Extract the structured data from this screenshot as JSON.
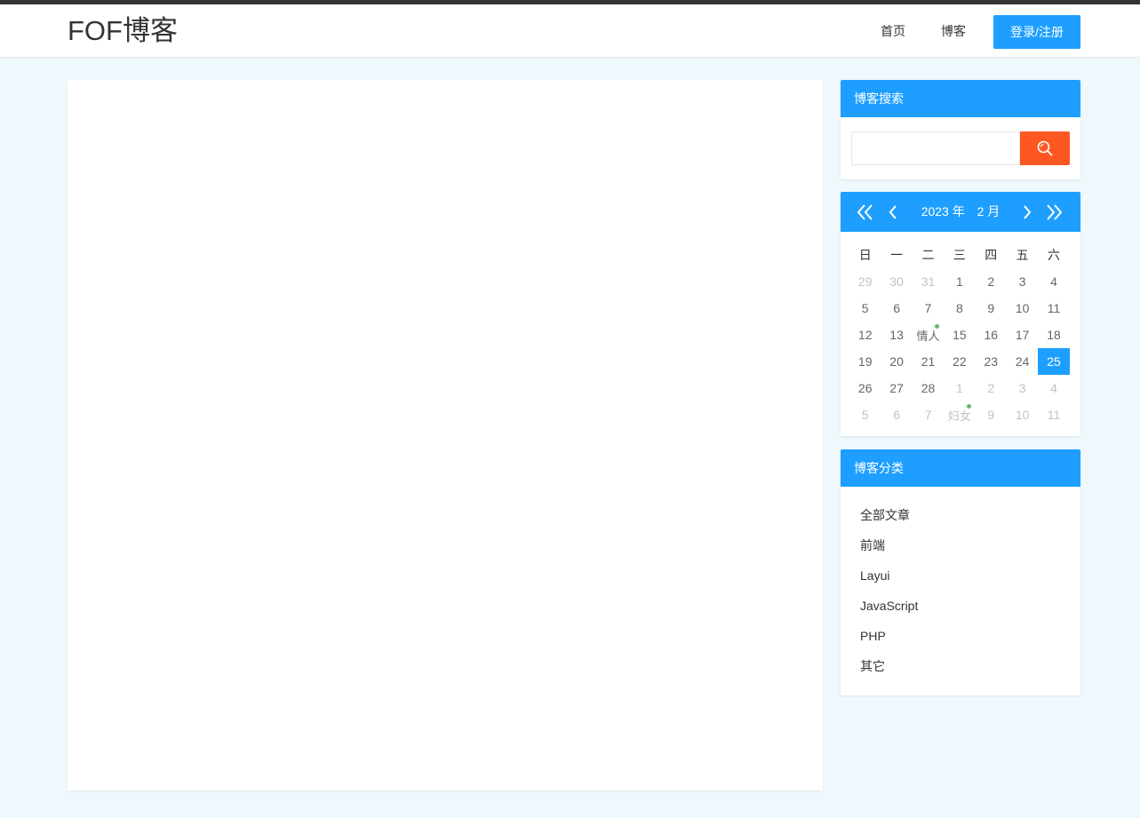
{
  "header": {
    "logo": "FOF博客",
    "nav_home": "首页",
    "nav_blog": "博客",
    "login_label": "登录/注册"
  },
  "search": {
    "title": "博客搜索",
    "value": "",
    "placeholder": ""
  },
  "calendar": {
    "year_label": "2023 年",
    "month_label": "2 月",
    "weekdays": [
      "日",
      "一",
      "二",
      "三",
      "四",
      "五",
      "六"
    ],
    "weeks": [
      [
        {
          "t": "29",
          "o": true
        },
        {
          "t": "30",
          "o": true
        },
        {
          "t": "31",
          "o": true
        },
        {
          "t": "1"
        },
        {
          "t": "2"
        },
        {
          "t": "3"
        },
        {
          "t": "4"
        }
      ],
      [
        {
          "t": "5"
        },
        {
          "t": "6"
        },
        {
          "t": "7"
        },
        {
          "t": "8"
        },
        {
          "t": "9"
        },
        {
          "t": "10"
        },
        {
          "t": "11"
        }
      ],
      [
        {
          "t": "12"
        },
        {
          "t": "13"
        },
        {
          "t": "情人",
          "f": true,
          "mark": true
        },
        {
          "t": "15"
        },
        {
          "t": "16"
        },
        {
          "t": "17"
        },
        {
          "t": "18"
        }
      ],
      [
        {
          "t": "19"
        },
        {
          "t": "20"
        },
        {
          "t": "21"
        },
        {
          "t": "22"
        },
        {
          "t": "23"
        },
        {
          "t": "24"
        },
        {
          "t": "25",
          "today": true
        }
      ],
      [
        {
          "t": "26"
        },
        {
          "t": "27"
        },
        {
          "t": "28"
        },
        {
          "t": "1",
          "o": true
        },
        {
          "t": "2",
          "o": true
        },
        {
          "t": "3",
          "o": true
        },
        {
          "t": "4",
          "o": true
        }
      ],
      [
        {
          "t": "5",
          "o": true
        },
        {
          "t": "6",
          "o": true
        },
        {
          "t": "7",
          "o": true
        },
        {
          "t": "妇女",
          "o": true,
          "f": true,
          "mark": true
        },
        {
          "t": "9",
          "o": true
        },
        {
          "t": "10",
          "o": true
        },
        {
          "t": "11",
          "o": true
        }
      ]
    ]
  },
  "categories": {
    "title": "博客分类",
    "items": [
      "全部文章",
      "前端",
      "Layui",
      "JavaScript",
      "PHP",
      "其它"
    ]
  },
  "colors": {
    "primary": "#1e9fff",
    "search_button": "#ff5722",
    "mark_dot": "#5fb878",
    "page_bg": "#eef8fd"
  }
}
